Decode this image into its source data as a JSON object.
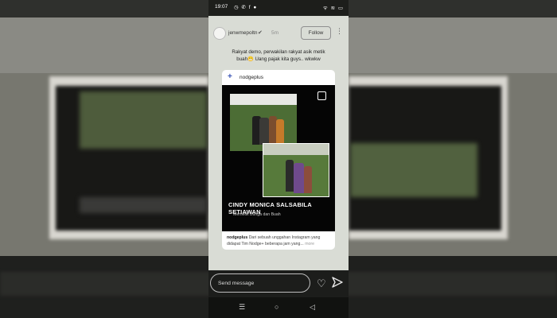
{
  "status": {
    "time": "19:07",
    "icons_left": "◷ ✆ f ●",
    "icons_right": "ᯤ ≋ ▭"
  },
  "header": {
    "username": "jenwmepoltn",
    "verified_icon": "verified-badge-icon",
    "time_ago": "5m",
    "follow_label": "Follow",
    "more_icon": "⋮"
  },
  "caption": {
    "line1": "Rakyat demo, perwakilan rakyat asik metik",
    "line2": "buah😬 Uang pajak kita guys.. wkwkw"
  },
  "post": {
    "author": "nodgeplus",
    "title": "CINDY MONICA SALSABILA SETIAWAN",
    "subtitle": "Memetik Bunga dan Buah",
    "desc_author": "nodgeplus",
    "desc_text": "Dari sebuah unggahan Instagram yang didapat Tim Nodge+ beberapa jam yang...",
    "desc_more": "more"
  },
  "message": {
    "placeholder": "Send message",
    "like_icon": "heart-icon",
    "send_icon": "paper-plane-icon"
  },
  "nav": {
    "recent": "☰",
    "home": "○",
    "back": "◁"
  }
}
